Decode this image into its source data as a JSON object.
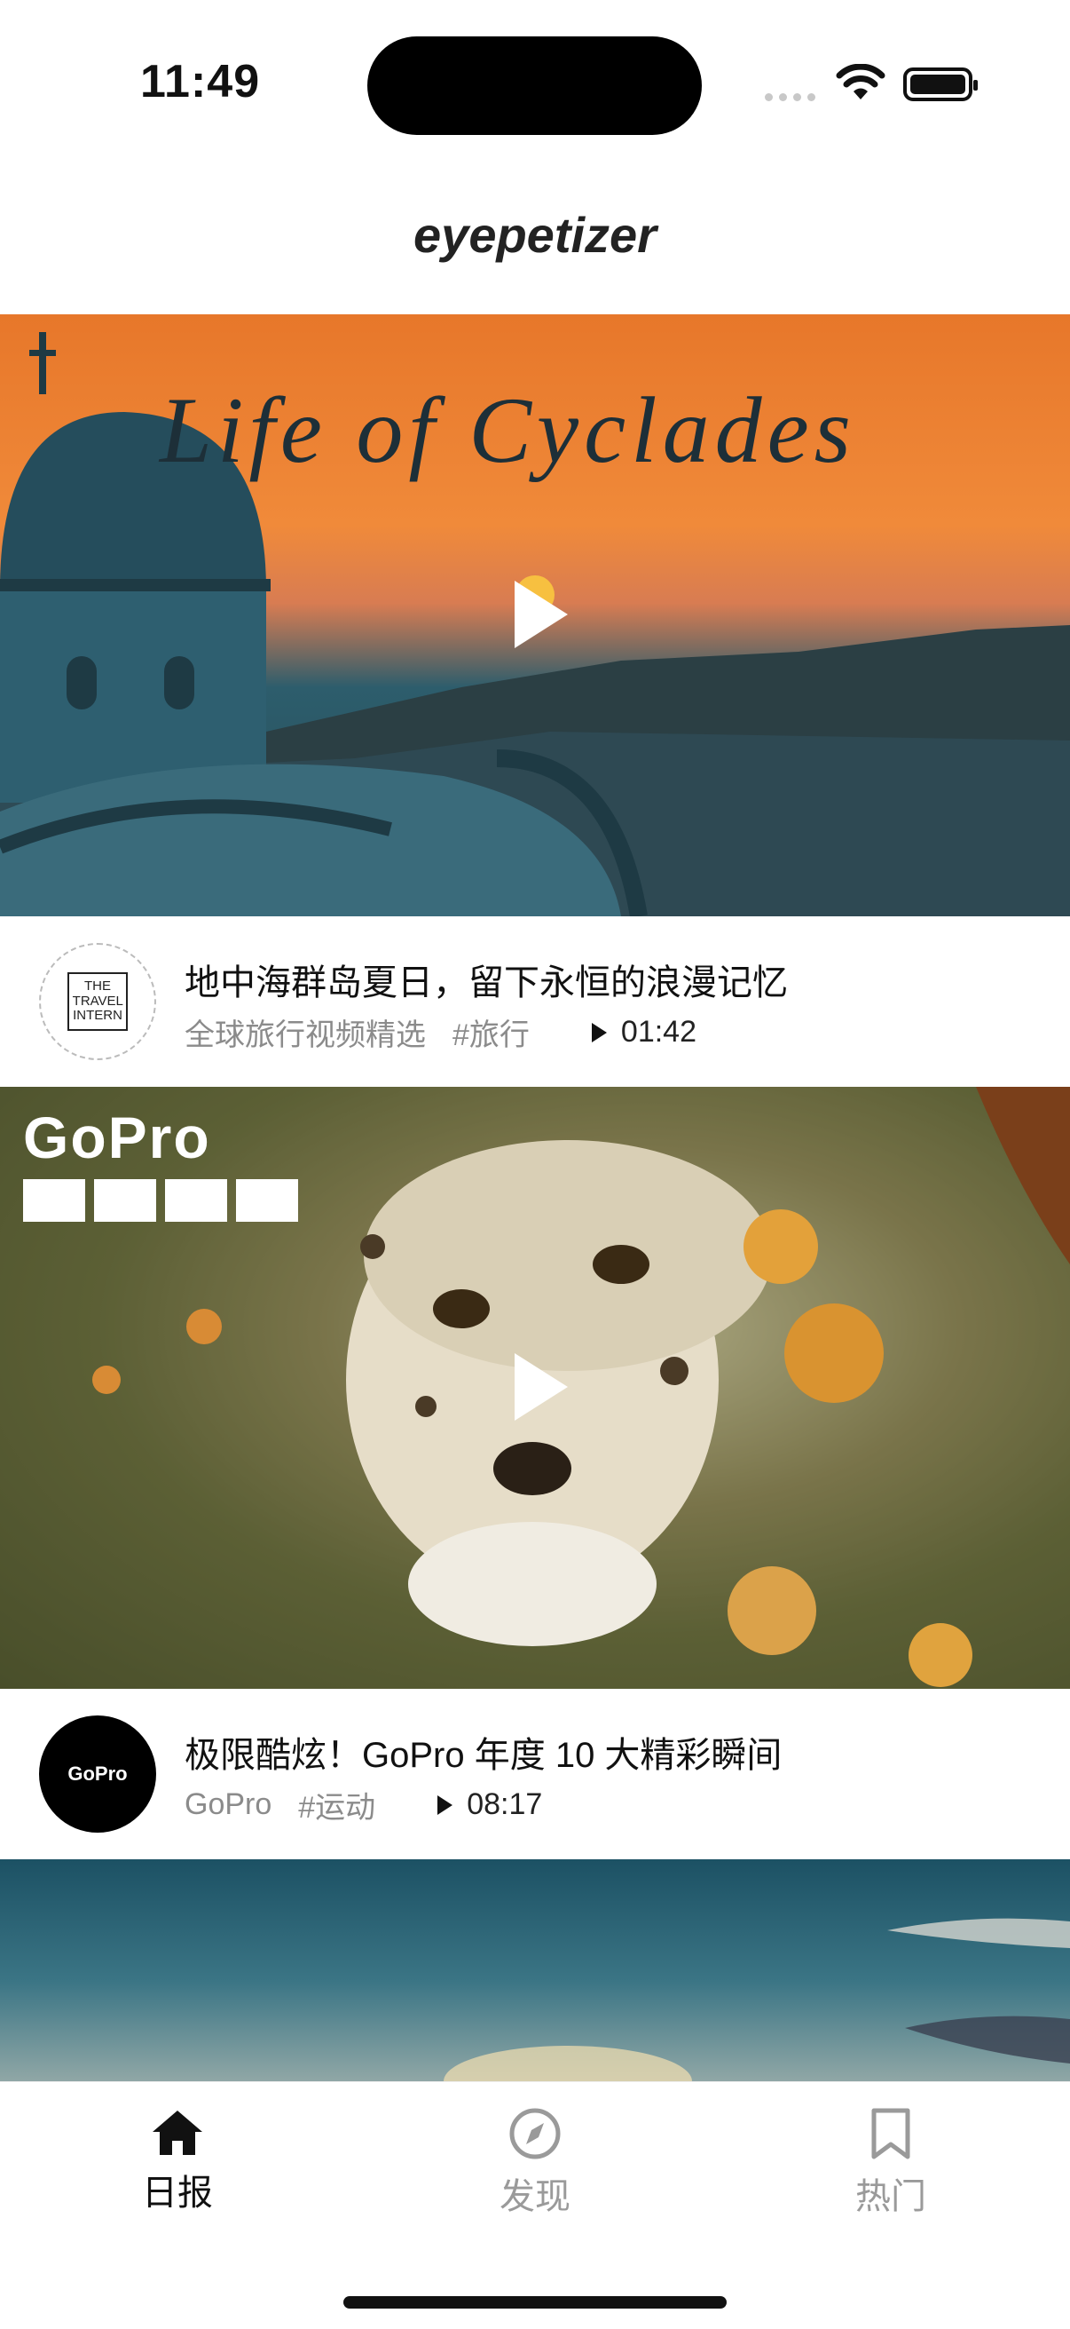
{
  "status_bar": {
    "time": "11:49"
  },
  "header": {
    "app_title": "eyepetizer"
  },
  "feed": [
    {
      "overlay_text": "Life of Cyclades",
      "title": "地中海群岛夏日，留下永恒的浪漫记忆",
      "author": "全球旅行视频精选",
      "tag": "#旅行",
      "duration": "01:42",
      "avatar_text": "THE TRAVEL INTERN"
    },
    {
      "overlay_text": "GoPro",
      "title": "极限酷炫！GoPro 年度 10 大精彩瞬间",
      "author": "GoPro",
      "tag": "#运动",
      "duration": "08:17",
      "avatar_text": "GoPro"
    }
  ],
  "tab_bar": {
    "items": [
      {
        "label": "日报",
        "icon": "home-icon",
        "active": true
      },
      {
        "label": "发现",
        "icon": "compass-icon",
        "active": false
      },
      {
        "label": "热门",
        "icon": "bookmark-icon",
        "active": false
      }
    ]
  }
}
